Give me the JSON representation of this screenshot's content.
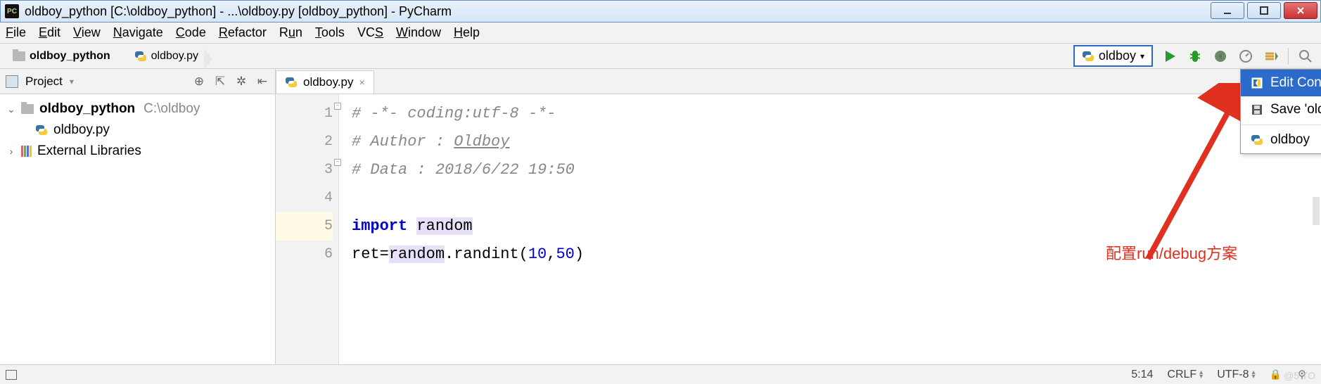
{
  "window": {
    "title": "oldboy_python [C:\\oldboy_python] - ...\\oldboy.py [oldboy_python] - PyCharm"
  },
  "menu": {
    "items": [
      "File",
      "Edit",
      "View",
      "Navigate",
      "Code",
      "Refactor",
      "Run",
      "Tools",
      "VCS",
      "Window",
      "Help"
    ]
  },
  "breadcrumb": {
    "items": [
      "oldboy_python",
      "oldboy.py"
    ]
  },
  "run_config": {
    "selected": "oldboy",
    "dropdown": {
      "edit": "Edit Configurations...",
      "save": "Save 'oldboy' Configuration",
      "item": "oldboy"
    }
  },
  "project_panel": {
    "title": "Project",
    "root": {
      "name": "oldboy_python",
      "path": "C:\\oldboy"
    },
    "file": "oldboy.py",
    "external": "External Libraries"
  },
  "tabs": [
    {
      "label": "oldboy.py"
    }
  ],
  "editor": {
    "lines": [
      "# -*- coding:utf-8 -*-",
      "# Author : Oldboy",
      "# Data : 2018/6/22 19:50",
      "",
      "import random",
      "ret=random.randint(10,50)"
    ],
    "line_numbers": [
      "1",
      "2",
      "3",
      "4",
      "5",
      "6"
    ]
  },
  "annotation": {
    "text": "配置run/debug方案"
  },
  "statusbar": {
    "pos": "5:14",
    "eol": "CRLF",
    "enc": "UTF-8"
  },
  "watermark": "@5 TO"
}
